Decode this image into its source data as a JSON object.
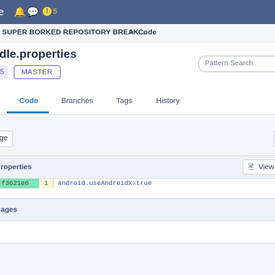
{
  "topbar": {
    "notification_count": "5",
    "alert_glyph": "!"
  },
  "breadcrumb": {
    "repo": "SUPER BORKED REPOSITORY BREAK ...",
    "separator": ">",
    "current": "Code"
  },
  "file": {
    "title": "dle.properties",
    "badge": "5",
    "branch": "MASTER"
  },
  "search": {
    "placeholder": "Pattern Search"
  },
  "tabs": [
    {
      "label": "Code",
      "active": true
    },
    {
      "label": "Branches",
      "active": false
    },
    {
      "label": "Tags",
      "active": false
    },
    {
      "label": "History",
      "active": false
    }
  ],
  "toolbar": {
    "left_button_label": "ge"
  },
  "panels": [
    {
      "title": "roperties",
      "view_button_label": "View",
      "lines": [
        {
          "commit": "f3621e6",
          "number": "1",
          "key": "android.useAndroidX",
          "op": "=",
          "value": "true"
        }
      ]
    },
    {
      "title": "ages"
    }
  ],
  "colors": {
    "topbar_bg": "#4b5f8b",
    "accent": "#2f7fb6",
    "branch_purple": "#6b5fd3",
    "commit_green": "#7ee3b6"
  },
  "icons": [
    "notification-bell-icon",
    "chat-bubbles-icon",
    "alert-icon",
    "document-icon"
  ]
}
